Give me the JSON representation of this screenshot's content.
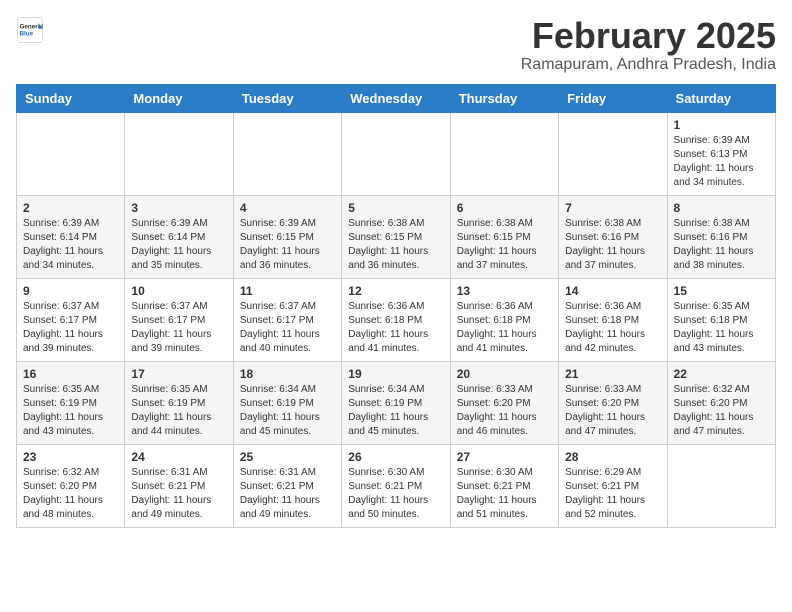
{
  "logo": {
    "general": "General",
    "blue": "Blue"
  },
  "title": "February 2025",
  "subtitle": "Ramapuram, Andhra Pradesh, India",
  "headers": [
    "Sunday",
    "Monday",
    "Tuesday",
    "Wednesday",
    "Thursday",
    "Friday",
    "Saturday"
  ],
  "weeks": [
    [
      {
        "day": "",
        "info": ""
      },
      {
        "day": "",
        "info": ""
      },
      {
        "day": "",
        "info": ""
      },
      {
        "day": "",
        "info": ""
      },
      {
        "day": "",
        "info": ""
      },
      {
        "day": "",
        "info": ""
      },
      {
        "day": "1",
        "info": "Sunrise: 6:39 AM\nSunset: 6:13 PM\nDaylight: 11 hours\nand 34 minutes."
      }
    ],
    [
      {
        "day": "2",
        "info": "Sunrise: 6:39 AM\nSunset: 6:14 PM\nDaylight: 11 hours\nand 34 minutes."
      },
      {
        "day": "3",
        "info": "Sunrise: 6:39 AM\nSunset: 6:14 PM\nDaylight: 11 hours\nand 35 minutes."
      },
      {
        "day": "4",
        "info": "Sunrise: 6:39 AM\nSunset: 6:15 PM\nDaylight: 11 hours\nand 36 minutes."
      },
      {
        "day": "5",
        "info": "Sunrise: 6:38 AM\nSunset: 6:15 PM\nDaylight: 11 hours\nand 36 minutes."
      },
      {
        "day": "6",
        "info": "Sunrise: 6:38 AM\nSunset: 6:15 PM\nDaylight: 11 hours\nand 37 minutes."
      },
      {
        "day": "7",
        "info": "Sunrise: 6:38 AM\nSunset: 6:16 PM\nDaylight: 11 hours\nand 37 minutes."
      },
      {
        "day": "8",
        "info": "Sunrise: 6:38 AM\nSunset: 6:16 PM\nDaylight: 11 hours\nand 38 minutes."
      }
    ],
    [
      {
        "day": "9",
        "info": "Sunrise: 6:37 AM\nSunset: 6:17 PM\nDaylight: 11 hours\nand 39 minutes."
      },
      {
        "day": "10",
        "info": "Sunrise: 6:37 AM\nSunset: 6:17 PM\nDaylight: 11 hours\nand 39 minutes."
      },
      {
        "day": "11",
        "info": "Sunrise: 6:37 AM\nSunset: 6:17 PM\nDaylight: 11 hours\nand 40 minutes."
      },
      {
        "day": "12",
        "info": "Sunrise: 6:36 AM\nSunset: 6:18 PM\nDaylight: 11 hours\nand 41 minutes."
      },
      {
        "day": "13",
        "info": "Sunrise: 6:36 AM\nSunset: 6:18 PM\nDaylight: 11 hours\nand 41 minutes."
      },
      {
        "day": "14",
        "info": "Sunrise: 6:36 AM\nSunset: 6:18 PM\nDaylight: 11 hours\nand 42 minutes."
      },
      {
        "day": "15",
        "info": "Sunrise: 6:35 AM\nSunset: 6:18 PM\nDaylight: 11 hours\nand 43 minutes."
      }
    ],
    [
      {
        "day": "16",
        "info": "Sunrise: 6:35 AM\nSunset: 6:19 PM\nDaylight: 11 hours\nand 43 minutes."
      },
      {
        "day": "17",
        "info": "Sunrise: 6:35 AM\nSunset: 6:19 PM\nDaylight: 11 hours\nand 44 minutes."
      },
      {
        "day": "18",
        "info": "Sunrise: 6:34 AM\nSunset: 6:19 PM\nDaylight: 11 hours\nand 45 minutes."
      },
      {
        "day": "19",
        "info": "Sunrise: 6:34 AM\nSunset: 6:19 PM\nDaylight: 11 hours\nand 45 minutes."
      },
      {
        "day": "20",
        "info": "Sunrise: 6:33 AM\nSunset: 6:20 PM\nDaylight: 11 hours\nand 46 minutes."
      },
      {
        "day": "21",
        "info": "Sunrise: 6:33 AM\nSunset: 6:20 PM\nDaylight: 11 hours\nand 47 minutes."
      },
      {
        "day": "22",
        "info": "Sunrise: 6:32 AM\nSunset: 6:20 PM\nDaylight: 11 hours\nand 47 minutes."
      }
    ],
    [
      {
        "day": "23",
        "info": "Sunrise: 6:32 AM\nSunset: 6:20 PM\nDaylight: 11 hours\nand 48 minutes."
      },
      {
        "day": "24",
        "info": "Sunrise: 6:31 AM\nSunset: 6:21 PM\nDaylight: 11 hours\nand 49 minutes."
      },
      {
        "day": "25",
        "info": "Sunrise: 6:31 AM\nSunset: 6:21 PM\nDaylight: 11 hours\nand 49 minutes."
      },
      {
        "day": "26",
        "info": "Sunrise: 6:30 AM\nSunset: 6:21 PM\nDaylight: 11 hours\nand 50 minutes."
      },
      {
        "day": "27",
        "info": "Sunrise: 6:30 AM\nSunset: 6:21 PM\nDaylight: 11 hours\nand 51 minutes."
      },
      {
        "day": "28",
        "info": "Sunrise: 6:29 AM\nSunset: 6:21 PM\nDaylight: 11 hours\nand 52 minutes."
      },
      {
        "day": "",
        "info": ""
      }
    ]
  ]
}
